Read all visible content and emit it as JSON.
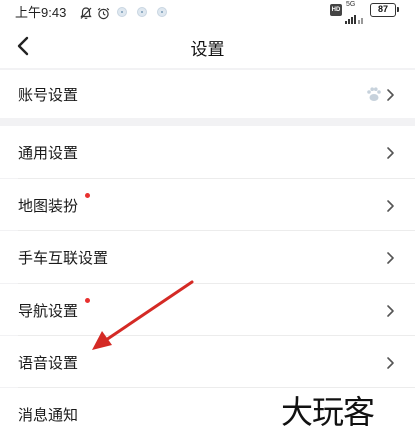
{
  "status_bar": {
    "time": "上午9:43",
    "hd": "HD",
    "signal": "5G",
    "battery": "87"
  },
  "header": {
    "title": "设置"
  },
  "menu": {
    "items": [
      {
        "label": "账号设置",
        "has_dot": false,
        "has_avatar": true
      },
      {
        "label": "通用设置",
        "has_dot": false
      },
      {
        "label": "地图装扮",
        "has_dot": true
      },
      {
        "label": "手车互联设置",
        "has_dot": false
      },
      {
        "label": "导航设置",
        "has_dot": true
      },
      {
        "label": "语音设置",
        "has_dot": false
      },
      {
        "label": "消息通知",
        "has_dot": false
      }
    ]
  },
  "watermark": "大玩客",
  "colors": {
    "background": "#f2f2f4",
    "item_bg": "#ffffff",
    "red_dot": "#e8312f",
    "arrow": "#d42a25"
  }
}
